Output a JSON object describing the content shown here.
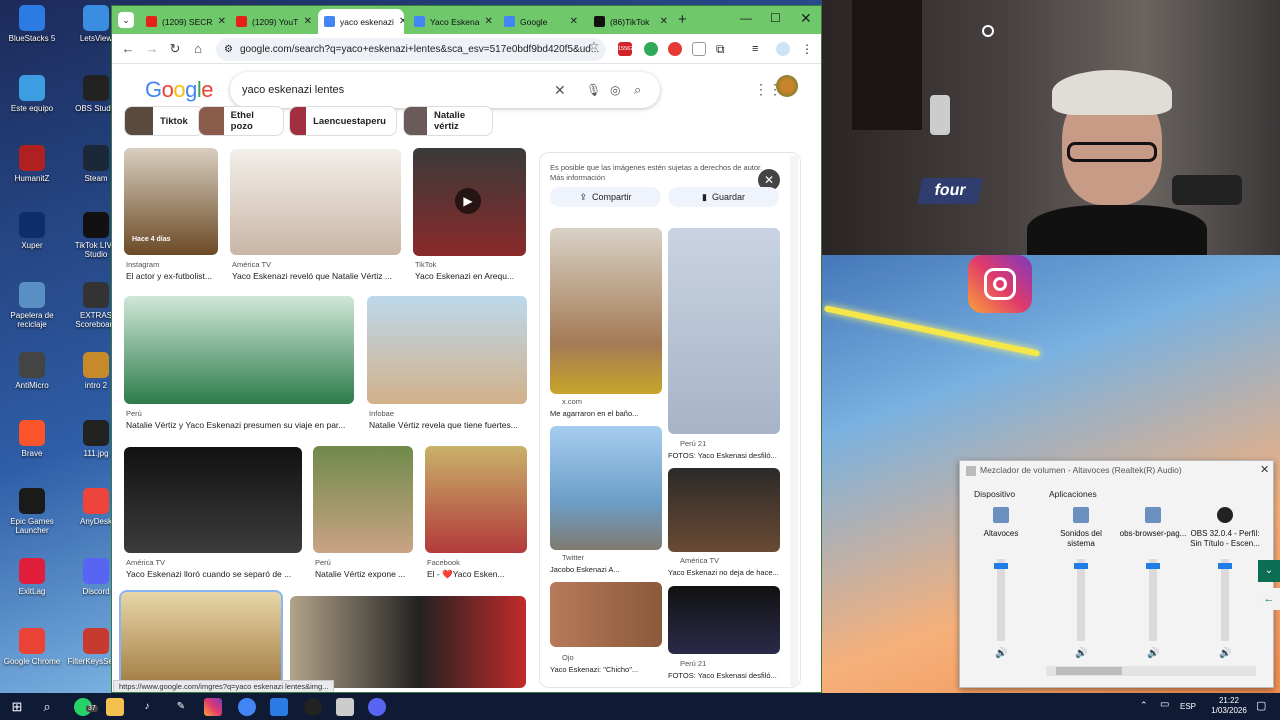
{
  "desktop_icons": [
    {
      "label": "BlueStacks 5",
      "color": "#2c7be5"
    },
    {
      "label": "LetsView",
      "color": "#3a8de0"
    },
    {
      "label": "Este equipo",
      "color": "#3c9ee0"
    },
    {
      "label": "OBS Studio",
      "color": "#222"
    },
    {
      "label": "HumanitZ",
      "color": "#b02020"
    },
    {
      "label": "Steam",
      "color": "#1b2838"
    },
    {
      "label": "Xuper",
      "color": "#0d2d6b"
    },
    {
      "label": "TikTok LIVE Studio",
      "color": "#111"
    },
    {
      "label": "Papelera de reciclaje",
      "color": "#5a8fc4"
    },
    {
      "label": "EXTRAS Scoreboard",
      "color": "#333"
    },
    {
      "label": "AntiMicro",
      "color": "#444"
    },
    {
      "label": "intro 2",
      "color": "#c78a2a"
    },
    {
      "label": "Brave",
      "color": "#fb542b"
    },
    {
      "label": "111.jpg",
      "color": "#222"
    },
    {
      "label": "Epic Games Launcher",
      "color": "#1a1a1a"
    },
    {
      "label": "AnyDesk",
      "color": "#ef443b"
    },
    {
      "label": "ExitLag",
      "color": "#e01e3c"
    },
    {
      "label": "Discord",
      "color": "#5865f2"
    },
    {
      "label": "Google Chrome",
      "color": "#ea4335"
    },
    {
      "label": "FilterKeysSetter",
      "color": "#c73a2f"
    }
  ],
  "browser": {
    "tabs": [
      {
        "title": "(1209) SECR",
        "color": "#e62117"
      },
      {
        "title": "(1209) YouT",
        "color": "#e62117"
      },
      {
        "title": "yaco eskenazi",
        "color": "#4285f4"
      },
      {
        "title": "Yaco Eskena",
        "color": "#4285f4"
      },
      {
        "title": "Google",
        "color": "#4285f4"
      },
      {
        "title": "(86)TikTok",
        "color": "#111"
      }
    ],
    "url": "google.com/search?q=yaco+eskenazi+lentes&sca_esv=517e0bdf9bd420f5&ud...",
    "ext_badge": "15562",
    "status_url": "https://www.google.com/imgres?q=yaco eskenazi lentes&img..."
  },
  "google": {
    "logo": "Google",
    "query": "yaco eskenazi lentes",
    "chips": [
      "Tiktok",
      "Ethel pozo",
      "Laencuestaperu",
      "Natalie vértiz"
    ]
  },
  "results": [
    {
      "source": "Instagram",
      "caption": "El actor y ex-futbolist...",
      "overlay": "Hace 4 días"
    },
    {
      "source": "América TV",
      "caption": "Yaco Eskenazi reveló que Natalie Vértiz ..."
    },
    {
      "source": "TikTok",
      "caption": "Yaco Eskenazi en Arequ..."
    },
    {
      "source": "Perú",
      "caption": "Natalie Vértiz y Yaco Eskenazi presumen su viaje en par..."
    },
    {
      "source": "Infobae",
      "caption": "Natalie Vértiz revela que tiene fuertes..."
    },
    {
      "source": "América TV",
      "caption": "Yaco Eskenazi lloró cuando se separó de ..."
    },
    {
      "source": "Perú",
      "caption": "Natalie Vértiz expone ..."
    },
    {
      "source": "Facebook",
      "caption": "El - ❤️Yaco Esken..."
    }
  ],
  "panel": {
    "notice": "Es posible que las imágenes estén sujetas a derechos de autor. Más información",
    "share": "Compartir",
    "save": "Guardar",
    "items": [
      {
        "source": "x.com",
        "caption": "Me agarraron en el baño..."
      },
      {
        "source": "Perú 21",
        "caption": "FOTOS: Yaco Eskenasi desfiló..."
      },
      {
        "source": "Twitter",
        "caption": "Jacobo Eskenazi A..."
      },
      {
        "source": "América TV",
        "caption": "Yaco Eskenazi no deja de hace..."
      },
      {
        "source": "Ojo",
        "caption": "Yaco Eskenazi: \"Chicho\"..."
      },
      {
        "source": "Perú 21",
        "caption": "FOTOS: Yaco Eskenasi desfiló..."
      }
    ]
  },
  "mixer": {
    "title": "Mezclador de volumen - Altavoces (Realtek(R) Audio)",
    "device_heading": "Dispositivo",
    "apps_heading": "Aplicaciones",
    "channels": [
      {
        "label": "Altavoces",
        "level": 0.95
      },
      {
        "label": "Sonidos del sistema",
        "level": 0.95
      },
      {
        "label": "obs-browser-pag...",
        "level": 0.95
      },
      {
        "label": "OBS 32.0.4 - Perfil: Sin Título - Escen...",
        "level": 0.95
      }
    ]
  },
  "taskbar": {
    "badge": "37",
    "lang": "ESP",
    "time": "21:22",
    "date": "1/03/2026"
  },
  "webcam": {
    "sign": "four"
  }
}
